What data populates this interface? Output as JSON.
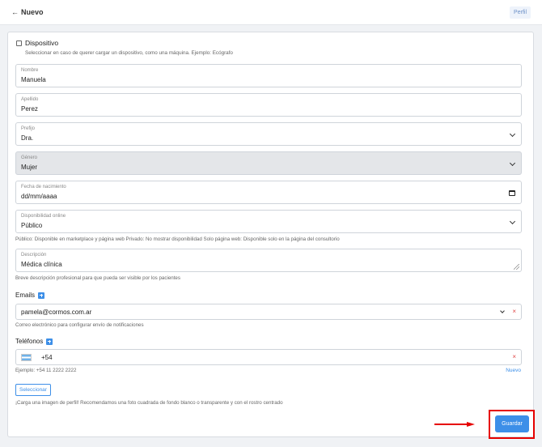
{
  "header": {
    "back_icon": "←",
    "title": "Nuevo",
    "profile_button": "Perfil"
  },
  "device": {
    "checked": false,
    "label": "Dispositivo",
    "help": "Seleccionar en caso de querer cargar un dispositivo, como una máquina. Ejemplo: Ecógrafo"
  },
  "fields": {
    "nombre": {
      "label": "Nombre",
      "value": "Manuela"
    },
    "apellido": {
      "label": "Apellido",
      "value": "Perez"
    },
    "prefijo": {
      "label": "Prefijo",
      "value": "Dra."
    },
    "genero": {
      "label": "Género",
      "value": "Mujer"
    },
    "fecha": {
      "label": "Fecha de nacimiento",
      "value": "dd/mm/aaaa"
    },
    "disponibilidad": {
      "label": "Disponibilidad online",
      "value": "Público",
      "help": "Público: Disponible en marketplace y página web   Privado: No mostrar disponibilidad   Solo página web: Disponible solo en la página del consultorio"
    },
    "descripcion": {
      "label": "Descripción",
      "value": "Médica clínica",
      "help": "Breve descripción profesional para que pueda ser visible por los pacientes"
    }
  },
  "emails": {
    "title": "Emails",
    "value": "pamela@cormos.com.ar",
    "remove": "×",
    "help": "Correo electrónico para configurar envío de notificaciones"
  },
  "phones": {
    "title": "Teléfonos",
    "prefix": "+54",
    "remove": "×",
    "help": "Ejemplo: +54 11 2222 2222",
    "new_link": "Nuevo"
  },
  "photo": {
    "button": "Seleccionar",
    "help": "¡Carga una imagen de perfil! Recomendamos una foto cuadrada de fondo blanco o transparente y con el rostro centrado"
  },
  "actions": {
    "save": "Guardar"
  },
  "colors": {
    "accent": "#3d8fe8",
    "annotation": "#e60000",
    "remove": "#e04848"
  }
}
